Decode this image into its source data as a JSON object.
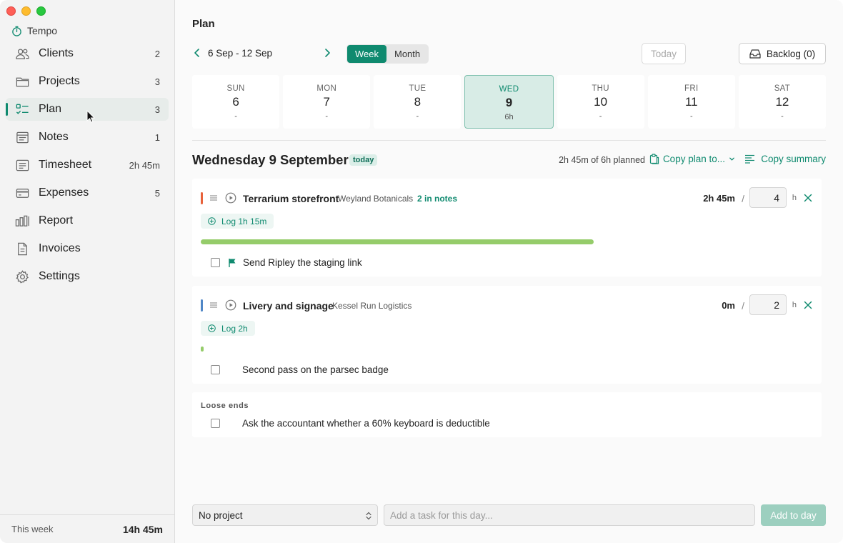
{
  "app": {
    "name": "Tempo"
  },
  "sidebar": {
    "items": [
      {
        "label": "Clients",
        "count": "2",
        "icon": "users-icon"
      },
      {
        "label": "Projects",
        "count": "3",
        "icon": "folder-icon"
      },
      {
        "label": "Plan",
        "count": "3",
        "icon": "checklist-icon",
        "active": true
      },
      {
        "label": "Notes",
        "count": "1",
        "icon": "notes-icon"
      },
      {
        "label": "Timesheet",
        "count": "2h 45m",
        "icon": "timesheet-icon"
      },
      {
        "label": "Expenses",
        "count": "5",
        "icon": "card-icon"
      },
      {
        "label": "Report",
        "count": "",
        "icon": "bar-chart-icon"
      },
      {
        "label": "Invoices",
        "count": "",
        "icon": "document-icon"
      },
      {
        "label": "Settings",
        "count": "",
        "icon": "gear-icon"
      }
    ],
    "footer": {
      "label": "This week",
      "value": "14h 45m"
    }
  },
  "main": {
    "title": "Plan",
    "range": "6 Sep - 12 Sep",
    "views": [
      "Week",
      "Month"
    ],
    "active_view": "Week",
    "today_label": "Today",
    "backlog_label": "Backlog (0)",
    "days": [
      {
        "name": "SUN",
        "num": "6",
        "hours": "-"
      },
      {
        "name": "MON",
        "num": "7",
        "hours": "-"
      },
      {
        "name": "TUE",
        "num": "8",
        "hours": "-"
      },
      {
        "name": "WED",
        "num": "9",
        "hours": "6h",
        "selected": true
      },
      {
        "name": "THU",
        "num": "10",
        "hours": "-"
      },
      {
        "name": "FRI",
        "num": "11",
        "hours": "-"
      },
      {
        "name": "SAT",
        "num": "12",
        "hours": "-"
      }
    ],
    "day_title": "Wednesday 9 September",
    "today_badge": "today",
    "planned": "2h 45m of 6h planned",
    "copy_plan": "Copy plan to...",
    "copy_summary": "Copy summary",
    "tasks": [
      {
        "title": "Terrarium storefront",
        "client": "Weyland Botanicals",
        "notes": "2 in notes",
        "spent": "2h 45m",
        "hours": "4",
        "unit": "h",
        "log": "Log 1h 15m",
        "progress": 0.6875,
        "color": "#e8623a",
        "subtask": "Send Ripley the staging link"
      },
      {
        "title": "Livery and signage",
        "client": "Kessel Run Logistics",
        "spent": "0m",
        "hours": "2",
        "unit": "h",
        "log": "Log 2h",
        "progress": 0,
        "color": "#4f86c6",
        "subtask": "Second pass on the parsec badge"
      }
    ],
    "loose_ends": {
      "label": "Loose ends",
      "item": "Ask the accountant whether a 60% keyboard is deductible"
    },
    "bottom": {
      "project": "No project",
      "task_placeholder": "Add a task for this day...",
      "add_label": "Add to day"
    }
  },
  "colors": {
    "accent": "#0f8a6f",
    "progress": "#95cc6a"
  }
}
